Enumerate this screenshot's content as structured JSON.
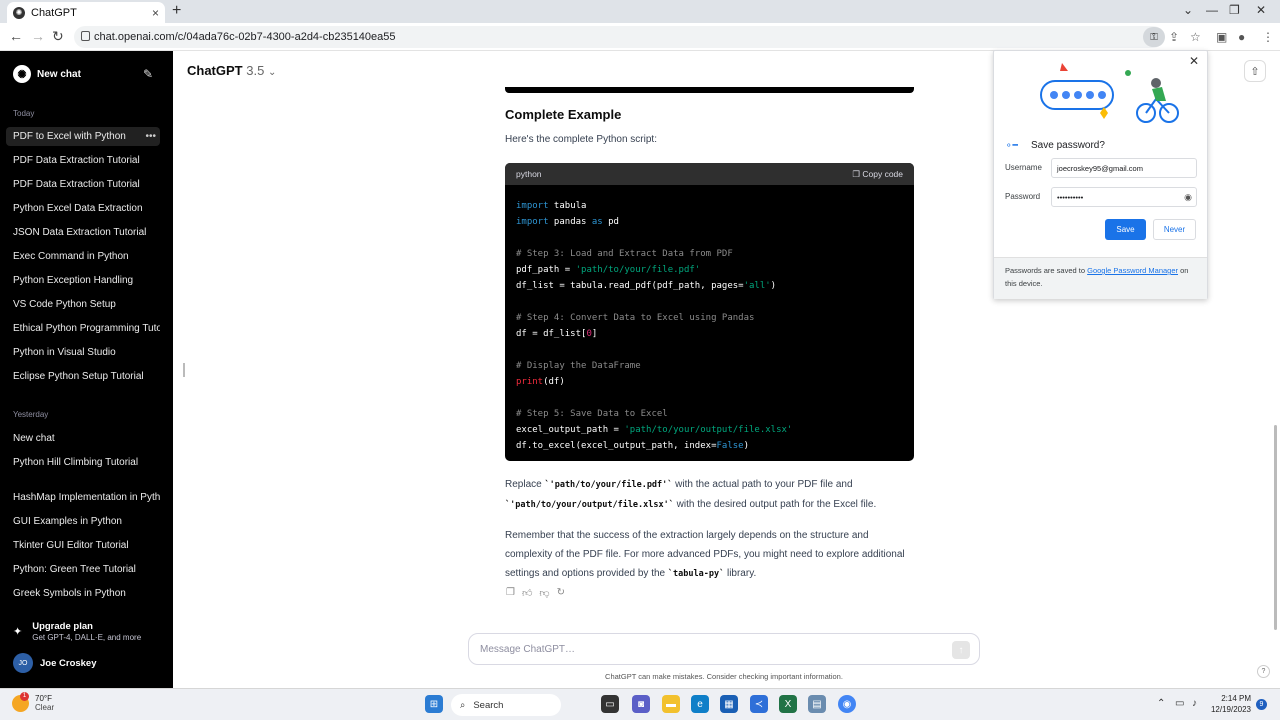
{
  "browser": {
    "tab_title": "ChatGPT",
    "tab_favicon": "openai-icon",
    "tab_close": "×",
    "new_tab": "+",
    "url": "chat.openai.com/c/04ada76c-02b7-4300-a2d4-cb235140ea55",
    "controls": {
      "minimize": "—",
      "restore": "❐",
      "close": "✕",
      "tab_menu": "⌄"
    },
    "nav": {
      "back": "←",
      "forward": "→",
      "reload": "↻"
    }
  },
  "sidebar": {
    "new_chat": "New chat",
    "today_label": "Today",
    "today_items": [
      "PDF to Excel with Python",
      "PDF Data Extraction Tutorial",
      "PDF Data Extraction Tutorial",
      "Python Excel Data Extraction",
      "JSON Data Extraction Tutorial",
      "Exec Command in Python",
      "Python Exception Handling",
      "VS Code Python Setup",
      "Ethical Python Programming Tuto",
      "Python in Visual Studio",
      "Eclipse Python Setup Tutorial"
    ],
    "yesterday_label": "Yesterday",
    "yesterday_items": [
      "New chat",
      "Python Hill Climbing Tutorial",
      "HashMap Implementation in Pyth",
      "GUI Examples in Python",
      "Tkinter GUI Editor Tutorial",
      "Python: Green Tree Tutorial",
      "Greek Symbols in Python"
    ],
    "active_item_dots": "•••",
    "upgrade_title": "Upgrade plan",
    "upgrade_sub": "Get GPT-4, DALL·E, and more",
    "user_initials": "JO",
    "user_name": "Joe Croskey"
  },
  "header": {
    "model_name": "ChatGPT",
    "model_version": "3.5",
    "chevron": "⌄"
  },
  "content": {
    "heading": "Complete Example",
    "intro": "Here's the complete Python script:",
    "code_lang": "python",
    "copy_label": "Copy code",
    "para1_a": "Replace ",
    "para1_code1": "`'path/to/your/file.pdf'`",
    "para1_b": " with the actual path to your PDF file and ",
    "para1_code2": "`'path/to/your/output/file.xlsx'`",
    "para1_c": " with the desired output path for the Excel file.",
    "para2_a": "Remember that the success of the extraction largely depends on the structure and complexity of the PDF file. For more advanced PDFs, you might need to explore additional settings and options provided by the ",
    "para2_code": "`tabula-py`",
    "para2_b": " library."
  },
  "composer": {
    "placeholder": "Message ChatGPT…",
    "disclaimer": "ChatGPT can make mistakes. Consider checking important information.",
    "help": "?"
  },
  "password_popup": {
    "title": "Save password?",
    "username_label": "Username",
    "username_value": "joecroskey95@gmail.com",
    "password_label": "Password",
    "password_value": "••••••••••",
    "save": "Save",
    "never": "Never",
    "footer_a": "Passwords are saved to ",
    "footer_link": "Google Password Manager",
    "footer_b": " on this device."
  },
  "taskbar": {
    "temp": "70°F",
    "condition": "Clear",
    "weather_badge": "1",
    "search": "Search",
    "time": "2:14 PM",
    "date": "12/19/2023",
    "notifications": "9"
  }
}
